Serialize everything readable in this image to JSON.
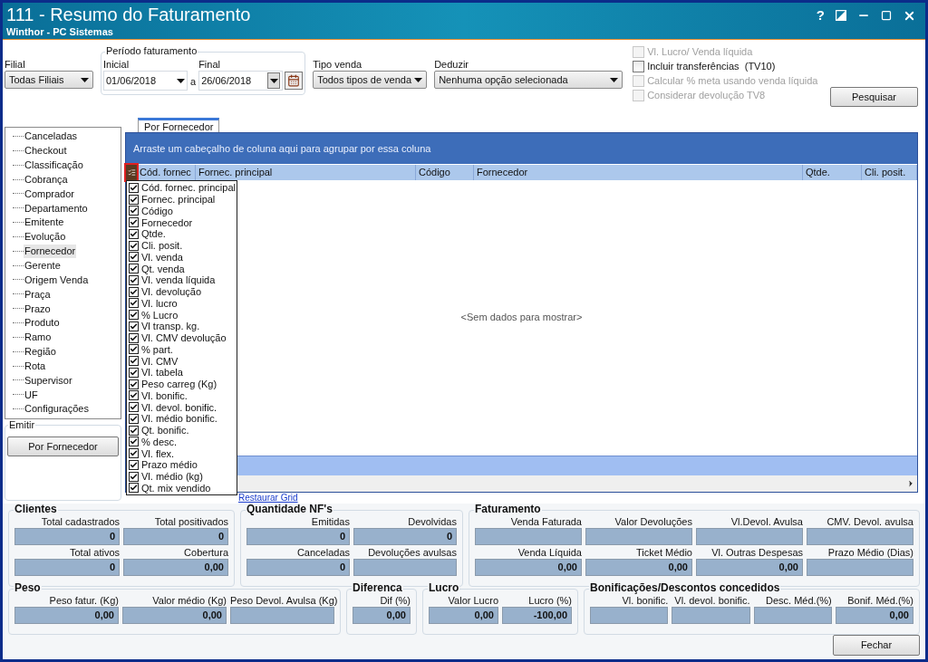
{
  "window": {
    "title": "111 - Resumo do Faturamento",
    "subtitle": "Winthor - PC Sistemas",
    "help": "?"
  },
  "filters": {
    "filial": {
      "label": "Filial",
      "value": "Todas Filiais"
    },
    "periodo": {
      "title": "Período faturamento",
      "inicial": {
        "label": "Inicial",
        "value": "01/06/2018"
      },
      "separator": "a",
      "final": {
        "label": "Final",
        "value": "26/06/2018"
      }
    },
    "tipo_venda": {
      "label": "Tipo venda",
      "value": "Todos tipos de venda"
    },
    "deduzir": {
      "label": "Deduzir",
      "value": "Nenhuma opção selecionada"
    },
    "options": [
      {
        "label": "Vl. Lucro/ Venda líquida",
        "checked": false,
        "disabled": true
      },
      {
        "label": "Incluir transferências  (TV10)",
        "checked": false,
        "disabled": false
      },
      {
        "label": "Calcular % meta usando venda líquida",
        "checked": false,
        "disabled": true
      },
      {
        "label": "Considerar devolução TV8",
        "checked": false,
        "disabled": true
      }
    ],
    "search_button": "Pesquisar"
  },
  "tree": {
    "items": [
      {
        "label": "Canceladas",
        "selected": false
      },
      {
        "label": "Checkout",
        "selected": false
      },
      {
        "label": "Classificação",
        "selected": false
      },
      {
        "label": "Cobrança",
        "selected": false
      },
      {
        "label": "Comprador",
        "selected": false
      },
      {
        "label": "Departamento",
        "selected": false
      },
      {
        "label": "Emitente",
        "selected": false
      },
      {
        "label": "Evolução",
        "selected": false
      },
      {
        "label": "Fornecedor",
        "selected": true
      },
      {
        "label": "Gerente",
        "selected": false
      },
      {
        "label": "Origem Venda",
        "selected": false
      },
      {
        "label": "Praça",
        "selected": false
      },
      {
        "label": "Prazo",
        "selected": false
      },
      {
        "label": "Produto",
        "selected": false
      },
      {
        "label": "Ramo",
        "selected": false
      },
      {
        "label": "Região",
        "selected": false
      },
      {
        "label": "Rota",
        "selected": false
      },
      {
        "label": "Supervisor",
        "selected": false
      },
      {
        "label": "UF",
        "selected": false
      },
      {
        "label": "Configurações",
        "selected": false
      }
    ]
  },
  "emitir": {
    "title": "Emitir",
    "button": "Por Fornecedor"
  },
  "tabs": [
    {
      "label": "Por Fornecedor",
      "selected": true
    }
  ],
  "grid": {
    "group_hint": "Arraste um cabeçalho de coluna aqui para agrupar por essa coluna",
    "columns": [
      "Cód. fornec",
      "Fornec. principal",
      "Código",
      "Fornecedor",
      "Qtde.",
      "Cli. posit."
    ],
    "empty_text": "<Sem dados para mostrar>",
    "restore_link": "Restaurar Grid"
  },
  "column_chooser": [
    {
      "label": "Cód. fornec. principal",
      "checked": true
    },
    {
      "label": "Fornec. principal",
      "checked": true
    },
    {
      "label": "Código",
      "checked": true
    },
    {
      "label": "Fornecedor",
      "checked": true
    },
    {
      "label": "Qtde.",
      "checked": true
    },
    {
      "label": "Cli. posit.",
      "checked": true
    },
    {
      "label": "Vl. venda",
      "checked": true
    },
    {
      "label": "Qt. venda",
      "checked": true
    },
    {
      "label": "Vl. venda líquida",
      "checked": true
    },
    {
      "label": "Vl. devolução",
      "checked": true
    },
    {
      "label": "Vl. lucro",
      "checked": true
    },
    {
      "label": "% Lucro",
      "checked": true
    },
    {
      "label": "Vl transp. kg.",
      "checked": true
    },
    {
      "label": "Vl. CMV devolução",
      "checked": true
    },
    {
      "label": "% part.",
      "checked": true
    },
    {
      "label": "Vl. CMV",
      "checked": true
    },
    {
      "label": "Vl. tabela",
      "checked": true
    },
    {
      "label": "Peso carreg (Kg)",
      "checked": true
    },
    {
      "label": "Vl. bonific.",
      "checked": true
    },
    {
      "label": "Vl. devol. bonific.",
      "checked": true
    },
    {
      "label": "Vl. médio bonific.",
      "checked": true
    },
    {
      "label": "Qt. bonific.",
      "checked": true
    },
    {
      "label": "% desc.",
      "checked": true
    },
    {
      "label": "Vl. flex.",
      "checked": true
    },
    {
      "label": "Prazo médio",
      "checked": true
    },
    {
      "label": "Vl. médio (kg)",
      "checked": true
    },
    {
      "label": "Qt. mix vendido",
      "checked": true
    }
  ],
  "summary_rows": [
    [
      {
        "title": "Clientes",
        "fields": [
          {
            "label": "Total cadastrados",
            "value": "0"
          },
          {
            "label": "Total positivados",
            "value": "0"
          },
          {
            "label": "Total ativos",
            "value": "0"
          },
          {
            "label": "Cobertura",
            "value": "0,00"
          }
        ]
      },
      {
        "title": "Quantidade NF's",
        "fields": [
          {
            "label": "Emitidas",
            "value": "0"
          },
          {
            "label": "Devolvidas",
            "value": "0"
          },
          {
            "label": "Canceladas",
            "value": "0"
          },
          {
            "label": "Devoluções avulsas"
          }
        ]
      },
      {
        "title": "Faturamento",
        "fields": [
          {
            "label": "Venda Faturada"
          },
          {
            "label": "Valor Devoluções"
          },
          {
            "label": "Vl.Devol. Avulsa"
          },
          {
            "label": "CMV. Devol. avulsa"
          },
          {
            "label": "Venda Líquida",
            "value": "0,00"
          },
          {
            "label": "Ticket Médio",
            "value": "0,00"
          },
          {
            "label": "Vl. Outras Despesas",
            "value": "0,00"
          },
          {
            "label": "Prazo Médio (Dias)"
          }
        ]
      }
    ],
    [
      {
        "title": "Peso",
        "fields": [
          {
            "label": "Peso fatur. (Kg)",
            "value": "0,00"
          },
          {
            "label": "Valor médio (Kg)",
            "value": "0,00"
          },
          {
            "label": "Peso Devol. Avulsa (Kg)"
          }
        ]
      },
      {
        "title": "Diferenca",
        "fields": [
          {
            "label": "Dif (%)",
            "value": "0,00"
          }
        ]
      },
      {
        "title": "Lucro",
        "fields": [
          {
            "label": "Valor Lucro",
            "value": "0,00"
          },
          {
            "label": "Lucro (%)",
            "value": "-100,00"
          }
        ]
      },
      {
        "title": "Bonificações/Descontos concedidos",
        "fields": [
          {
            "label": "Vl. bonific."
          },
          {
            "label": "Vl. devol. bonific."
          },
          {
            "label": "Desc. Méd.(%)"
          },
          {
            "label": "Bonif. Méd.(%)",
            "value": "0,00"
          }
        ]
      }
    ]
  ],
  "close_button": "Fechar"
}
